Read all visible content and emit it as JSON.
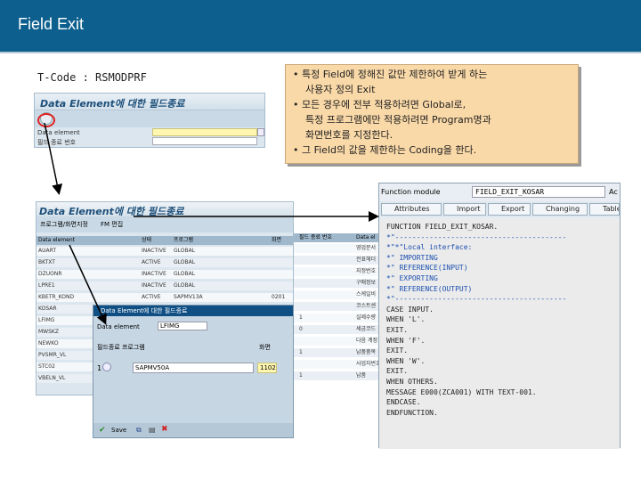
{
  "slide_title": "Field Exit",
  "tcode_label": "T-Code : RSMODPRF",
  "notes": [
    "• 특정 Field에 정해진 값만 제한하여 받게 하는",
    "사용자 정의 Exit",
    "• 모든 경우에 전부 적용하려면 Global로,",
    "특정 프로그램에만 적용하려면 Program명과",
    "화면번호를 지정한다.",
    "• 그 Field의 값을 제한하는 Coding을 한다."
  ],
  "win1": {
    "title": "Data Element에 대한 필드종료",
    "field1_label": "Data element",
    "field2_label": "필드 종료 번호"
  },
  "win2": {
    "title": "Data Element에 대한 필드종료",
    "menu": [
      "프로그램/화면지정",
      "FM 편집"
    ],
    "columns": [
      "Data element",
      "상태",
      "프로그램",
      "화면",
      "필드 종료 번호",
      "Data el"
    ],
    "rows": [
      [
        "AUART",
        "INACTIVE",
        "GLOBAL",
        "",
        "",
        "영업문서"
      ],
      [
        "BKTXT",
        "ACTIVE",
        "GLOBAL",
        "",
        "",
        "전표헤더"
      ],
      [
        "DZUONR",
        "INACTIVE",
        "GLOBAL",
        "",
        "",
        "지정번호"
      ],
      [
        "LPRE1",
        "INACTIVE",
        "GLOBAL",
        "",
        "",
        "구매정보"
      ],
      [
        "KBETR_KOND",
        "ACTIVE",
        "SAPMV13A",
        "0201",
        "",
        "스케일비"
      ],
      [
        "KOSAR",
        "",
        "",
        "",
        "",
        "코스트센"
      ],
      [
        "LFIMG",
        "",
        "",
        "",
        "1",
        "실제수량"
      ],
      [
        "MWSKZ",
        "",
        "",
        "",
        "0",
        "세금코드"
      ],
      [
        "NEWKO",
        "",
        "",
        "",
        "",
        "다음 계정"
      ],
      [
        "PVSMR_VL",
        "",
        "",
        "",
        "1",
        "납품품목"
      ],
      [
        "STC02",
        "",
        "",
        "",
        "",
        "사업자번호"
      ],
      [
        "VBELN_VL",
        "",
        "",
        "",
        "1",
        "납품"
      ]
    ]
  },
  "win3": {
    "title": "Data Element에 대한 필드종료",
    "de_label": "Data element",
    "de_value": "LFIMG",
    "col_prog": "필드종료 프로그램",
    "col_dynpro": "화면",
    "row_no": "1",
    "program": "SAPMV50A",
    "dynpro": "1102",
    "save_label": "Save"
  },
  "win4": {
    "fm_label": "Function module",
    "fm_value": "FIELD_EXIT_KOSAR",
    "fm_extra": "Ac",
    "tabs": [
      "Attributes",
      "Import",
      "Export",
      "Changing",
      "Tables"
    ],
    "code": [
      "FUNCTION FIELD_EXIT_KOSAR.",
      "*\"----------------------------------------",
      "*\"*\"Local interface:",
      "*\"   IMPORTING",
      "*\"      REFERENCE(INPUT)",
      "*\"   EXPORTING",
      "*\"      REFERENCE(OUTPUT)",
      "*\"----------------------------------------",
      "  CASE INPUT.",
      "    WHEN 'L'.",
      "      EXIT.",
      "    WHEN 'F'.",
      "      EXIT.",
      "    WHEN 'W'.",
      "      EXIT.",
      "    WHEN OTHERS.",
      "      MESSAGE E000(ZCA001) WITH TEXT-001.",
      "  ENDCASE.",
      "ENDFUNCTION."
    ]
  },
  "colors": {
    "title_bar": "#0d5f8e",
    "note_bg": "#fad9a8",
    "popup_header": "#0f4f84",
    "highlight": "#e02020"
  }
}
